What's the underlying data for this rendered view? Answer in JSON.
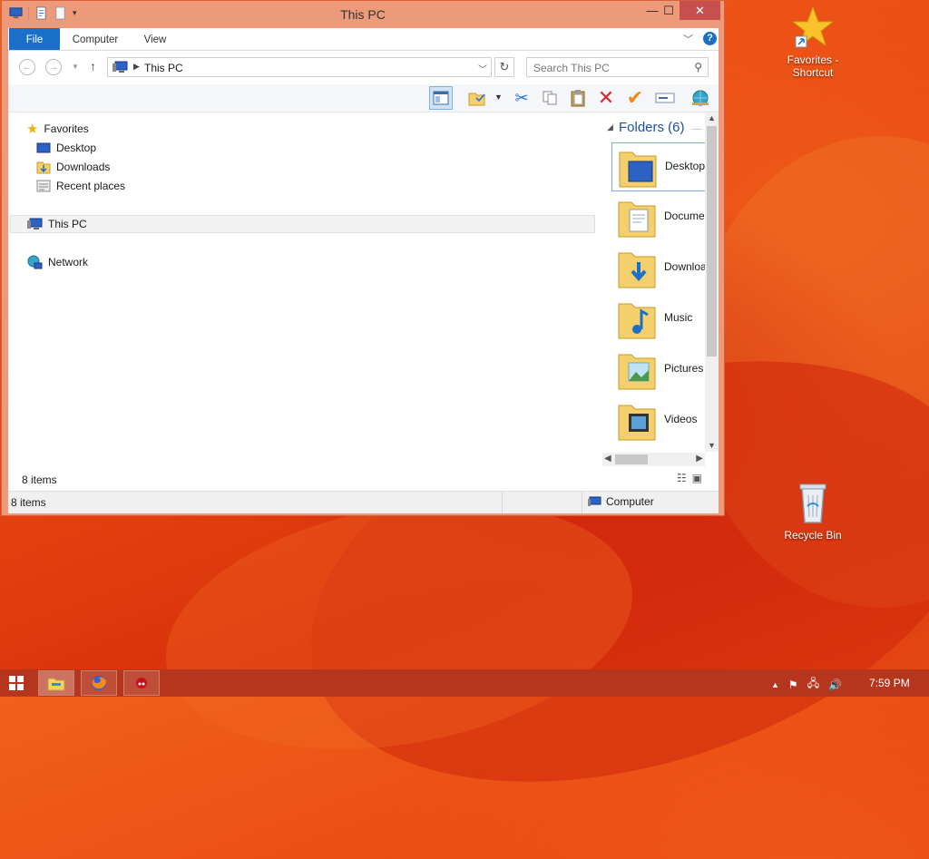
{
  "window": {
    "title": "This PC"
  },
  "controls": {
    "minimize": "—",
    "maximize": "☐",
    "close": "✕"
  },
  "ribbon": {
    "tabs": [
      {
        "label": "File"
      },
      {
        "label": "Computer"
      },
      {
        "label": "View"
      }
    ]
  },
  "address": {
    "path": "This PC"
  },
  "search": {
    "placeholder": "Search This PC"
  },
  "navpane": {
    "favorites": "Favorites",
    "favorites_items": [
      {
        "label": "Desktop"
      },
      {
        "label": "Downloads"
      },
      {
        "label": "Recent places"
      }
    ],
    "this_pc": "This PC",
    "network": "Network"
  },
  "content": {
    "group": "Folders (6)",
    "folders": [
      {
        "label": "Desktop"
      },
      {
        "label": "Documents"
      },
      {
        "label": "Downloads"
      },
      {
        "label": "Music"
      },
      {
        "label": "Pictures"
      },
      {
        "label": "Videos"
      }
    ],
    "item_count": "8 items"
  },
  "statusbar": {
    "count": "8 items",
    "zone": "Computer"
  },
  "desktop": {
    "favorites_shortcut": "Favorites - Shortcut",
    "recycle_bin": "Recycle Bin"
  },
  "taskbar": {
    "clock": "7:59 PM"
  },
  "colors": {
    "accent": "#1a6fc9",
    "window_frame": "#ec9a7a",
    "close_red": "#c7504f",
    "taskbar": "#b5361d"
  }
}
